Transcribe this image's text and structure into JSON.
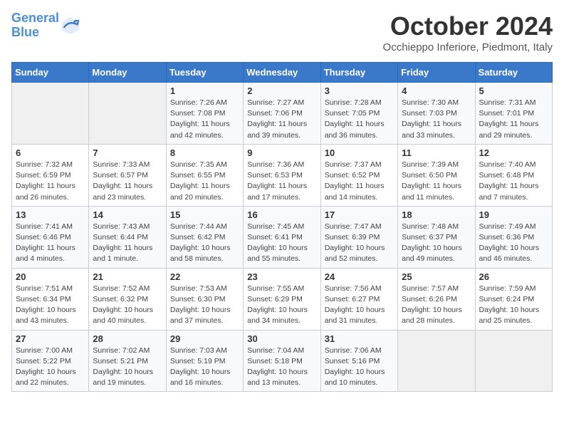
{
  "header": {
    "logo_line1": "General",
    "logo_line2": "Blue",
    "month": "October 2024",
    "location": "Occhieppo Inferiore, Piedmont, Italy"
  },
  "weekdays": [
    "Sunday",
    "Monday",
    "Tuesday",
    "Wednesday",
    "Thursday",
    "Friday",
    "Saturday"
  ],
  "weeks": [
    [
      {
        "day": "",
        "info": ""
      },
      {
        "day": "",
        "info": ""
      },
      {
        "day": "1",
        "info": "Sunrise: 7:26 AM\nSunset: 7:08 PM\nDaylight: 11 hours and 42 minutes."
      },
      {
        "day": "2",
        "info": "Sunrise: 7:27 AM\nSunset: 7:06 PM\nDaylight: 11 hours and 39 minutes."
      },
      {
        "day": "3",
        "info": "Sunrise: 7:28 AM\nSunset: 7:05 PM\nDaylight: 11 hours and 36 minutes."
      },
      {
        "day": "4",
        "info": "Sunrise: 7:30 AM\nSunset: 7:03 PM\nDaylight: 11 hours and 33 minutes."
      },
      {
        "day": "5",
        "info": "Sunrise: 7:31 AM\nSunset: 7:01 PM\nDaylight: 11 hours and 29 minutes."
      }
    ],
    [
      {
        "day": "6",
        "info": "Sunrise: 7:32 AM\nSunset: 6:59 PM\nDaylight: 11 hours and 26 minutes."
      },
      {
        "day": "7",
        "info": "Sunrise: 7:33 AM\nSunset: 6:57 PM\nDaylight: 11 hours and 23 minutes."
      },
      {
        "day": "8",
        "info": "Sunrise: 7:35 AM\nSunset: 6:55 PM\nDaylight: 11 hours and 20 minutes."
      },
      {
        "day": "9",
        "info": "Sunrise: 7:36 AM\nSunset: 6:53 PM\nDaylight: 11 hours and 17 minutes."
      },
      {
        "day": "10",
        "info": "Sunrise: 7:37 AM\nSunset: 6:52 PM\nDaylight: 11 hours and 14 minutes."
      },
      {
        "day": "11",
        "info": "Sunrise: 7:39 AM\nSunset: 6:50 PM\nDaylight: 11 hours and 11 minutes."
      },
      {
        "day": "12",
        "info": "Sunrise: 7:40 AM\nSunset: 6:48 PM\nDaylight: 11 hours and 7 minutes."
      }
    ],
    [
      {
        "day": "13",
        "info": "Sunrise: 7:41 AM\nSunset: 6:46 PM\nDaylight: 11 hours and 4 minutes."
      },
      {
        "day": "14",
        "info": "Sunrise: 7:43 AM\nSunset: 6:44 PM\nDaylight: 11 hours and 1 minute."
      },
      {
        "day": "15",
        "info": "Sunrise: 7:44 AM\nSunset: 6:42 PM\nDaylight: 10 hours and 58 minutes."
      },
      {
        "day": "16",
        "info": "Sunrise: 7:45 AM\nSunset: 6:41 PM\nDaylight: 10 hours and 55 minutes."
      },
      {
        "day": "17",
        "info": "Sunrise: 7:47 AM\nSunset: 6:39 PM\nDaylight: 10 hours and 52 minutes."
      },
      {
        "day": "18",
        "info": "Sunrise: 7:48 AM\nSunset: 6:37 PM\nDaylight: 10 hours and 49 minutes."
      },
      {
        "day": "19",
        "info": "Sunrise: 7:49 AM\nSunset: 6:36 PM\nDaylight: 10 hours and 46 minutes."
      }
    ],
    [
      {
        "day": "20",
        "info": "Sunrise: 7:51 AM\nSunset: 6:34 PM\nDaylight: 10 hours and 43 minutes."
      },
      {
        "day": "21",
        "info": "Sunrise: 7:52 AM\nSunset: 6:32 PM\nDaylight: 10 hours and 40 minutes."
      },
      {
        "day": "22",
        "info": "Sunrise: 7:53 AM\nSunset: 6:30 PM\nDaylight: 10 hours and 37 minutes."
      },
      {
        "day": "23",
        "info": "Sunrise: 7:55 AM\nSunset: 6:29 PM\nDaylight: 10 hours and 34 minutes."
      },
      {
        "day": "24",
        "info": "Sunrise: 7:56 AM\nSunset: 6:27 PM\nDaylight: 10 hours and 31 minutes."
      },
      {
        "day": "25",
        "info": "Sunrise: 7:57 AM\nSunset: 6:26 PM\nDaylight: 10 hours and 28 minutes."
      },
      {
        "day": "26",
        "info": "Sunrise: 7:59 AM\nSunset: 6:24 PM\nDaylight: 10 hours and 25 minutes."
      }
    ],
    [
      {
        "day": "27",
        "info": "Sunrise: 7:00 AM\nSunset: 5:22 PM\nDaylight: 10 hours and 22 minutes."
      },
      {
        "day": "28",
        "info": "Sunrise: 7:02 AM\nSunset: 5:21 PM\nDaylight: 10 hours and 19 minutes."
      },
      {
        "day": "29",
        "info": "Sunrise: 7:03 AM\nSunset: 5:19 PM\nDaylight: 10 hours and 16 minutes."
      },
      {
        "day": "30",
        "info": "Sunrise: 7:04 AM\nSunset: 5:18 PM\nDaylight: 10 hours and 13 minutes."
      },
      {
        "day": "31",
        "info": "Sunrise: 7:06 AM\nSunset: 5:16 PM\nDaylight: 10 hours and 10 minutes."
      },
      {
        "day": "",
        "info": ""
      },
      {
        "day": "",
        "info": ""
      }
    ]
  ]
}
